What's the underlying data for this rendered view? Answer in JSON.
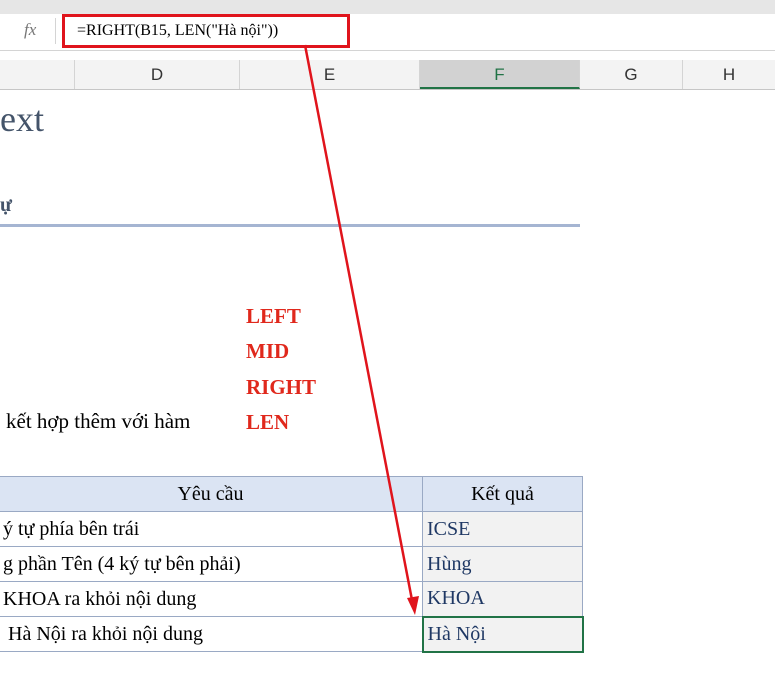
{
  "formula_bar": {
    "fx_label": "fx",
    "formula": "=RIGHT(B15,  LEN(\"Hà nội\"))"
  },
  "columns": [
    "D",
    "E",
    "F",
    "G",
    "H"
  ],
  "sheet": {
    "title": "ext",
    "subtitle": "ự",
    "functions": [
      "LEFT",
      "MID",
      "RIGHT",
      "LEN"
    ],
    "description": "kết hợp thêm với hàm",
    "table": {
      "headers": [
        "Yêu cầu",
        "Kết quả"
      ],
      "rows": [
        {
          "request": "ý tự phía bên trái",
          "result": "ICSE"
        },
        {
          "request": "g phần Tên (4 ký tự bên phải)",
          "result": "Hùng"
        },
        {
          "request": " KHOA ra khỏi nội dung",
          "result": "KHOA"
        },
        {
          "request": " Hà Nội ra khỏi nội dung",
          "result": "Hà Nội"
        }
      ]
    }
  },
  "annotation_color": "#e0141c"
}
